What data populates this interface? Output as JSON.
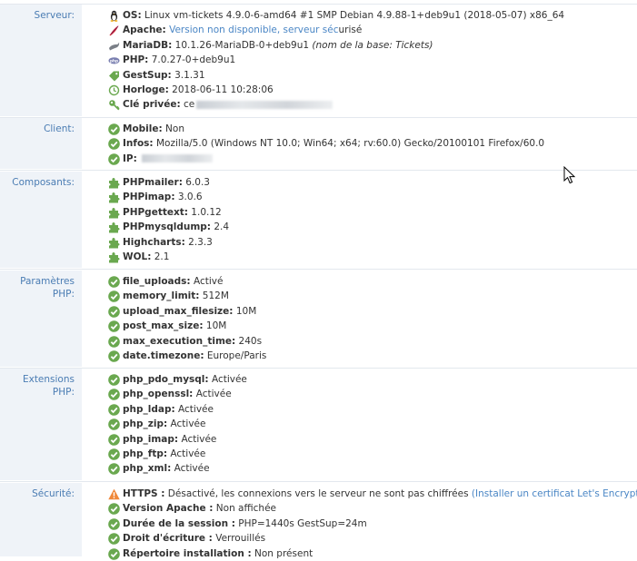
{
  "sections": {
    "serveur": {
      "label": "Serveur:",
      "items": [
        {
          "icon": "linux-icon",
          "key": "OS:",
          "value": " Linux vm-tickets 4.9.0-6-amd64 #1 SMP Debian 4.9.88-1+deb9u1 (2018-05-07) x86_64"
        },
        {
          "icon": "apache-feather-icon",
          "key": "Apache:",
          "link": " Version non disponible, serveur séc",
          "value": "urisé"
        },
        {
          "icon": "mariadb-icon",
          "key": "MariaDB:",
          "value": " 10.1.26-MariaDB-0+deb9u1 ",
          "note": "(nom de la base: Tickets)"
        },
        {
          "icon": "php-icon",
          "key": "PHP:",
          "value": " 7.0.27-0+deb9u1"
        },
        {
          "icon": "gestsup-tag-icon",
          "key": "GestSup:",
          "value": " 3.1.31"
        },
        {
          "icon": "clock-icon",
          "key": "Horloge:",
          "value": " 2018-06-11 10:28:06"
        },
        {
          "icon": "key-icon",
          "key": "Clé privée:",
          "value": " ce"
        }
      ]
    },
    "client": {
      "label": "Client:",
      "items": [
        {
          "icon": "check-icon",
          "key": "Mobile:",
          "value": " Non"
        },
        {
          "icon": "check-icon",
          "key": "Infos:",
          "value": " Mozilla/5.0 (Windows NT 10.0; Win64; x64; rv:60.0) Gecko/20100101 Firefox/60.0"
        },
        {
          "icon": "check-icon",
          "key": "IP:",
          "value": " "
        }
      ]
    },
    "composants": {
      "label": "Composants:",
      "items": [
        {
          "icon": "puzzle-icon",
          "key": "PHPmailer:",
          "value": " 6.0.3"
        },
        {
          "icon": "puzzle-icon",
          "key": "PHPimap:",
          "value": " 3.0.6"
        },
        {
          "icon": "puzzle-icon",
          "key": "PHPgettext:",
          "value": " 1.0.12"
        },
        {
          "icon": "puzzle-icon",
          "key": "PHPmysqldump:",
          "value": " 2.4"
        },
        {
          "icon": "puzzle-icon",
          "key": "Highcharts:",
          "value": " 2.3.3"
        },
        {
          "icon": "puzzle-icon",
          "key": "WOL:",
          "value": " 2.1"
        }
      ]
    },
    "parametres": {
      "label_line1": "Paramètres",
      "label_line2": "PHP:",
      "items": [
        {
          "icon": "check-icon",
          "key": "file_uploads:",
          "value": " Activé"
        },
        {
          "icon": "check-icon",
          "key": "memory_limit:",
          "value": " 512M"
        },
        {
          "icon": "check-icon",
          "key": "upload_max_filesize:",
          "value": " 10M"
        },
        {
          "icon": "check-icon",
          "key": "post_max_size:",
          "value": " 10M"
        },
        {
          "icon": "check-icon",
          "key": "max_execution_time:",
          "value": " 240s"
        },
        {
          "icon": "check-icon",
          "key": "date.timezone:",
          "value": " Europe/Paris"
        }
      ]
    },
    "extensions": {
      "label": "Extensions PHP:",
      "items": [
        {
          "icon": "check-icon",
          "key": "php_pdo_mysql:",
          "value": " Activée"
        },
        {
          "icon": "check-icon",
          "key": "php_openssl:",
          "value": " Activée"
        },
        {
          "icon": "check-icon",
          "key": "php_ldap:",
          "value": " Activée"
        },
        {
          "icon": "check-icon",
          "key": "php_zip:",
          "value": " Activée"
        },
        {
          "icon": "check-icon",
          "key": "php_imap:",
          "value": " Activée"
        },
        {
          "icon": "check-icon",
          "key": "php_ftp:",
          "value": " Activée"
        },
        {
          "icon": "check-icon",
          "key": "php_xml:",
          "value": " Activée"
        }
      ]
    },
    "securite": {
      "label": "Sécurité:",
      "items": [
        {
          "icon": "warning-icon",
          "key": "HTTPS :",
          "value": " Désactivé, les connexions vers le serveur ne sont pas chiffrées ",
          "link": "(Installer un certificat Let's Encrypt)",
          "tail": "."
        },
        {
          "icon": "check-icon",
          "key": "Version Apache :",
          "value": " Non affichée"
        },
        {
          "icon": "check-icon",
          "key": "Durée de la session :",
          "value": " PHP=1440s GestSup=24m"
        },
        {
          "icon": "check-icon",
          "key": "Droit d'écriture :",
          "value": " Verrouillés"
        },
        {
          "icon": "check-icon",
          "key": "Répertoire installation :",
          "value": " Non présent"
        }
      ]
    }
  },
  "colors": {
    "label": "#4a7cb3",
    "label_bg": "#eff3f8",
    "check": "#6aa84f",
    "warning": "#f0883a",
    "link": "#4a86c5"
  }
}
